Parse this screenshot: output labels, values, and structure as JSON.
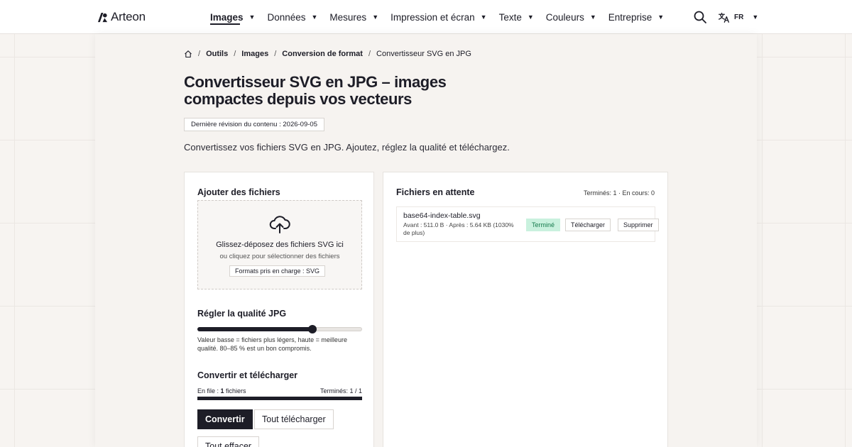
{
  "header": {
    "brand": "Arteon",
    "nav": [
      {
        "label": "Images",
        "active": true
      },
      {
        "label": "Données"
      },
      {
        "label": "Mesures"
      },
      {
        "label": "Impression et écran"
      },
      {
        "label": "Texte"
      },
      {
        "label": "Couleurs"
      },
      {
        "label": "Entreprise"
      }
    ],
    "language": "FR"
  },
  "breadcrumb": [
    "Outils",
    "Images",
    "Conversion de format",
    "Convertisseur SVG en JPG"
  ],
  "page": {
    "title": "Convertisseur SVG en JPG – images compactes depuis vos vecteurs",
    "revision": "Dernière révision du contenu : 2026-09-05",
    "intro": "Convertissez vos fichiers SVG en JPG. Ajoutez, réglez la qualité et téléchargez."
  },
  "upload": {
    "heading": "Ajouter des fichiers",
    "drop_title": "Glissez-déposez des fichiers SVG ici",
    "drop_subtitle": "ou cliquez pour sélectionner des fichiers",
    "formats": "Formats pris en charge : SVG"
  },
  "quality": {
    "heading": "Régler la qualité JPG",
    "value_fraction": 0.7,
    "hint": "Valeur basse = fichiers plus légers, haute = meilleure qualité. 80–85 % est un bon compromis."
  },
  "convert": {
    "heading": "Convertir et télécharger",
    "queue_label": "En file : ",
    "queue_count": "1",
    "queue_suffix": " fichiers",
    "done_label": "Terminés: 1 / 1",
    "progress_fraction": 1.0,
    "convert_button": "Convertir",
    "download_all_button": "Tout télécharger",
    "clear_button": "Tout effacer"
  },
  "pending": {
    "heading": "Fichiers en attente",
    "summary": "Terminés: 1 · En cours: 0",
    "files": [
      {
        "name": "base64-index-table.svg",
        "meta": "Avant : 511.0 B · Après : 5.64 KB (1030% de plus)",
        "status": "Terminé",
        "download_label": "Télécharger",
        "delete_label": "Supprimer"
      }
    ]
  },
  "colors": {
    "ink": "#1d1d27",
    "success_bg": "#c9f1de",
    "success_text": "#157a4c"
  },
  "icons": [
    "logo-mark",
    "search-icon",
    "translate-icon",
    "home-icon",
    "upload-cloud-icon"
  ]
}
